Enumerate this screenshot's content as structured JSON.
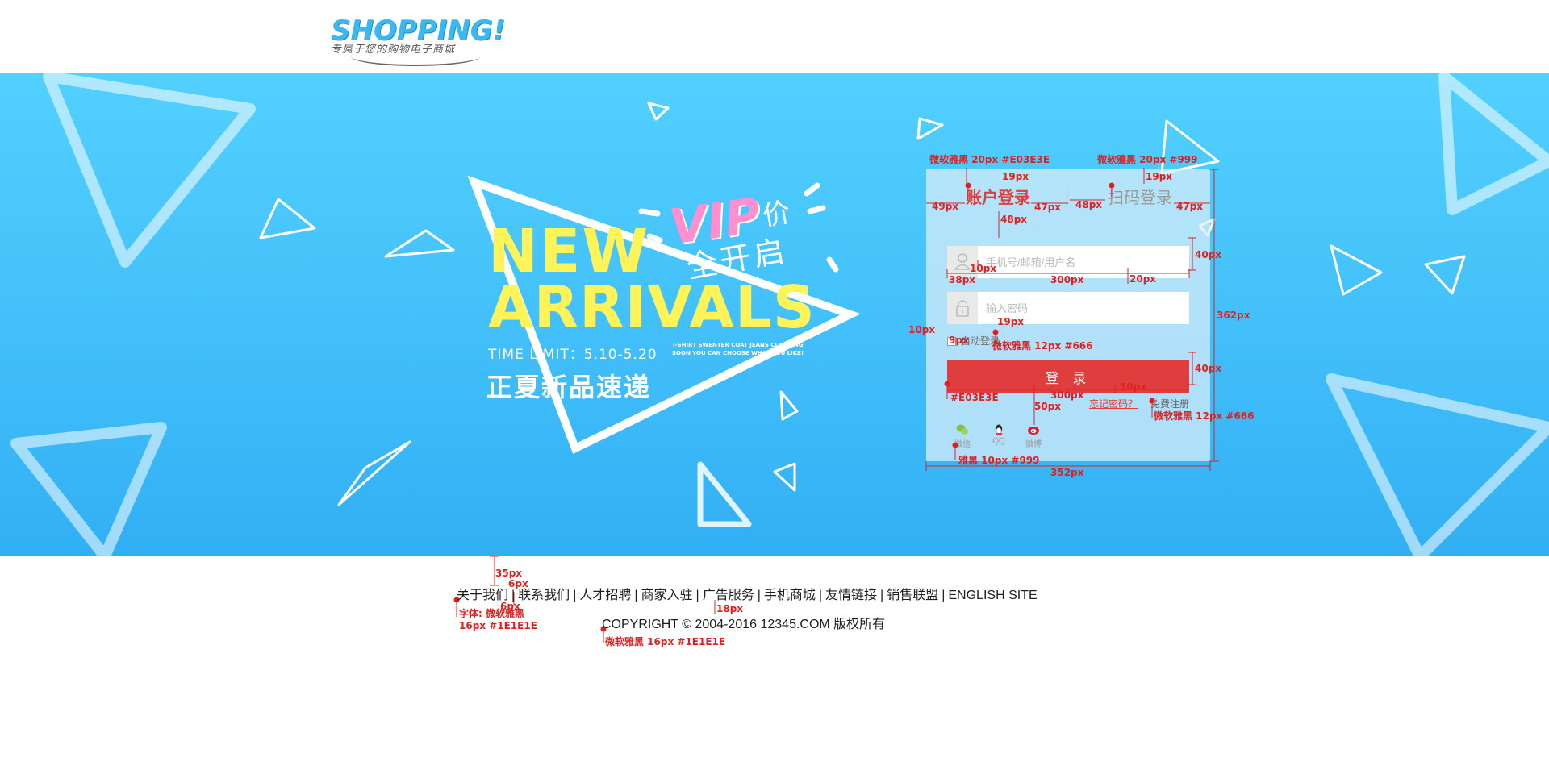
{
  "header": {
    "logo_title": "SHOPPING!",
    "logo_subtitle": "专属于您的购物电子商城"
  },
  "banner": {
    "promo_new": "NEW",
    "promo_arrivals": "ARRIVALS",
    "promo_vip": "VIP",
    "promo_vip_suffix": "价",
    "promo_all_open": "全开启",
    "promo_time": "TIME LIMIT：5.10-5.20",
    "promo_small_line1": "T-SHIRT SWENTER COAT JEANS CLOTHING",
    "promo_small_line2": "SOON YOU CAN CHOOSE WHAT YOU LIKE!",
    "promo_cn": "正夏新品速递"
  },
  "login": {
    "tab_account": "账户登录",
    "tab_qr": "扫码登录",
    "username_placeholder": "手机号/邮箱/用户名",
    "password_placeholder": "输入密码",
    "auto_login": "自动登录",
    "login_button": "登 录",
    "forgot_password": "忘记密码？",
    "register": "免费注册",
    "social": [
      {
        "label": "微信",
        "icon": "wechat-icon"
      },
      {
        "label": "QQ",
        "icon": "qq-icon"
      },
      {
        "label": "微博",
        "icon": "weibo-icon"
      }
    ],
    "colors": {
      "accent": "#E03E3E",
      "muted": "#999",
      "text": "#666"
    }
  },
  "annotations": {
    "a1": "微软雅黑 20px #E03E3E",
    "a2": "微软雅黑 20px #999",
    "a3": "19px",
    "a4": "19px",
    "a5": "49px",
    "a6": "47px",
    "a7": "48px",
    "a8": "47px",
    "a9": "48px",
    "a10": "40px",
    "a11": "10px",
    "a12": "38px",
    "a13": "300px",
    "a14": "20px",
    "a15": "362px",
    "a16": "10px",
    "a17": "19px",
    "a18": "9px",
    "a19": "微软雅黑 12px #666",
    "a20": "40px",
    "a21": "10px",
    "a22": "#E03E3E",
    "a23": "300px",
    "a24": "50px",
    "a25": "微软雅黑 12px #666",
    "a26": "雅黑 10px #999",
    "a27": "352px",
    "a28": "35px",
    "a29": "6px",
    "a30": "6px",
    "a31": "字体: 微软雅黑",
    "a32": "16px #1E1E1E",
    "a33": "18px",
    "a34": "微软雅黑 16px #1E1E1E"
  },
  "footer": {
    "links": [
      "关于我们",
      "联系我们",
      "人才招聘",
      "商家入驻",
      "广告服务",
      "手机商城",
      "友情链接",
      "销售联盟",
      "ENGLISH SITE"
    ],
    "separator": "|",
    "copyright": "COPYRIGHT © 2004-2016  12345.COM 版权所有"
  }
}
